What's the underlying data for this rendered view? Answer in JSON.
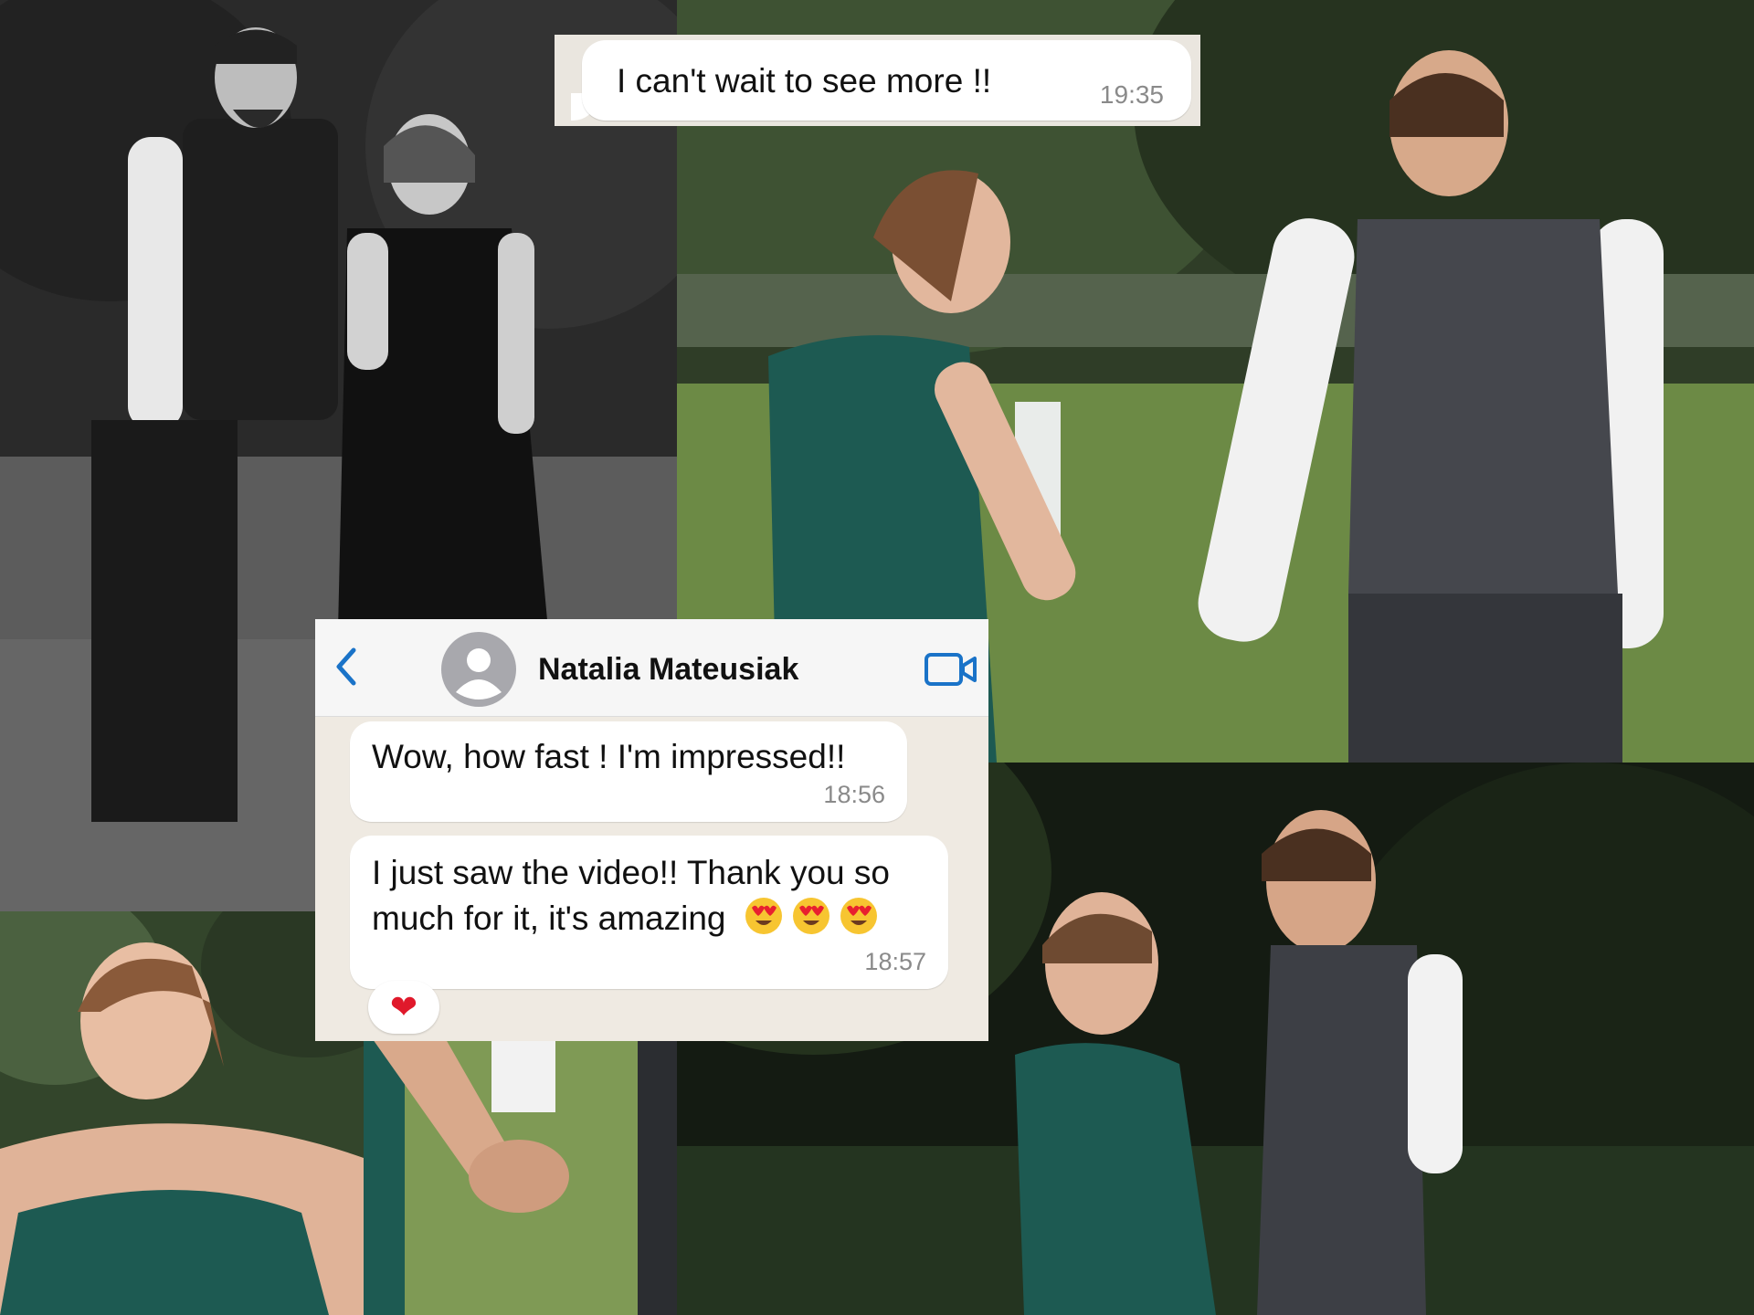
{
  "top_message": {
    "text": "I can't wait to see more !!",
    "time": "19:35"
  },
  "chat": {
    "contact_name": "Natalia Mateusiak",
    "messages": [
      {
        "text": "Wow, how fast ! I'm impressed!!",
        "time": "18:56"
      },
      {
        "text": "I just saw the video!! Thank you so much for it, it's amazing",
        "emojis": "😍 😍 😍",
        "time": "18:57"
      }
    ],
    "reaction": "❤"
  },
  "icons": [
    "chevron-left-icon",
    "avatar-placeholder-icon",
    "video-call-icon",
    "heart-eyes-emoji",
    "heart-reaction-icon"
  ],
  "colors": {
    "ios_blue": "#1a73c8",
    "chat_bg": "#efeae2",
    "bubble": "#ffffff",
    "dress_green": "#1d5a52"
  }
}
